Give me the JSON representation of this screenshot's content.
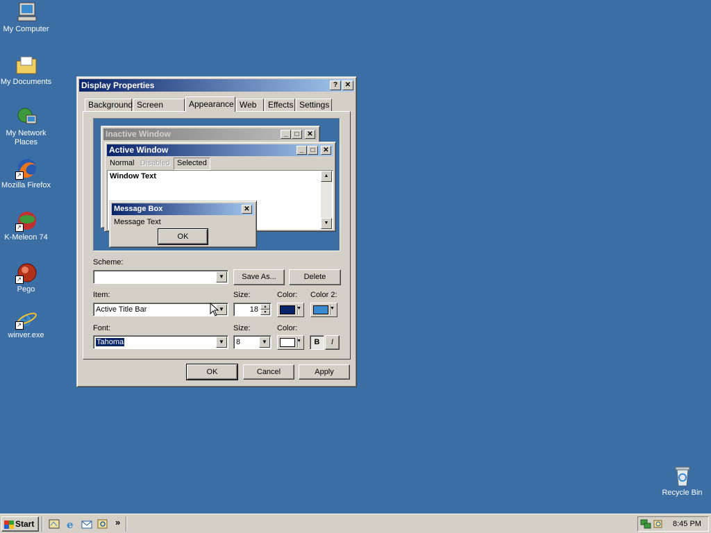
{
  "desktop": {
    "icons": [
      {
        "label": "My Computer",
        "icon": "computer-icon"
      },
      {
        "label": "My Documents",
        "icon": "folder-icon"
      },
      {
        "label": "My Network Places",
        "icon": "network-icon"
      },
      {
        "label": "Mozilla Firefox",
        "icon": "firefox-icon"
      },
      {
        "label": "K-Meleon 74",
        "icon": "kmeleon-icon"
      },
      {
        "label": "Pego",
        "icon": "pego-icon"
      },
      {
        "label": "winver.exe",
        "icon": "ie-icon"
      },
      {
        "label": "Recycle Bin",
        "icon": "recycle-bin-icon"
      }
    ]
  },
  "dialog": {
    "title": "Display Properties",
    "help": "?",
    "close": "✕",
    "tabs": [
      "Background",
      "Screen Saver",
      "Appearance",
      "Web",
      "Effects",
      "Settings"
    ],
    "selected_tab": "Appearance",
    "preview": {
      "inactive_title": "Inactive Window",
      "active_title": "Active Window",
      "menu": [
        "Normal",
        "Disabled",
        "Selected"
      ],
      "window_text": "Window Text",
      "message_box_title": "Message Box",
      "message_text": "Message Text",
      "ok": "OK"
    },
    "scheme": {
      "label": "Scheme:",
      "value": "",
      "save_as": "Save As...",
      "delete": "Delete"
    },
    "item": {
      "label": "Item:",
      "value": "Active Title Bar",
      "size_label": "Size:",
      "size_value": "18",
      "color_label": "Color:",
      "color2_label": "Color 2:",
      "color": "#0a246a",
      "color2": "#3a8ad0"
    },
    "font": {
      "label": "Font:",
      "value": "Tahoma",
      "size_label": "Size:",
      "size_value": "8",
      "color_label": "Color:",
      "color": "#ffffff",
      "bold": "B",
      "italic": "I"
    },
    "buttons": {
      "ok": "OK",
      "cancel": "Cancel",
      "apply": "Apply"
    }
  },
  "taskbar": {
    "start": "Start",
    "chevron": "»",
    "clock": "8:45 PM"
  },
  "colors": {
    "desktop": "#3a6ea5",
    "active_title": "#0a246a",
    "face": "#d4d0c8"
  }
}
